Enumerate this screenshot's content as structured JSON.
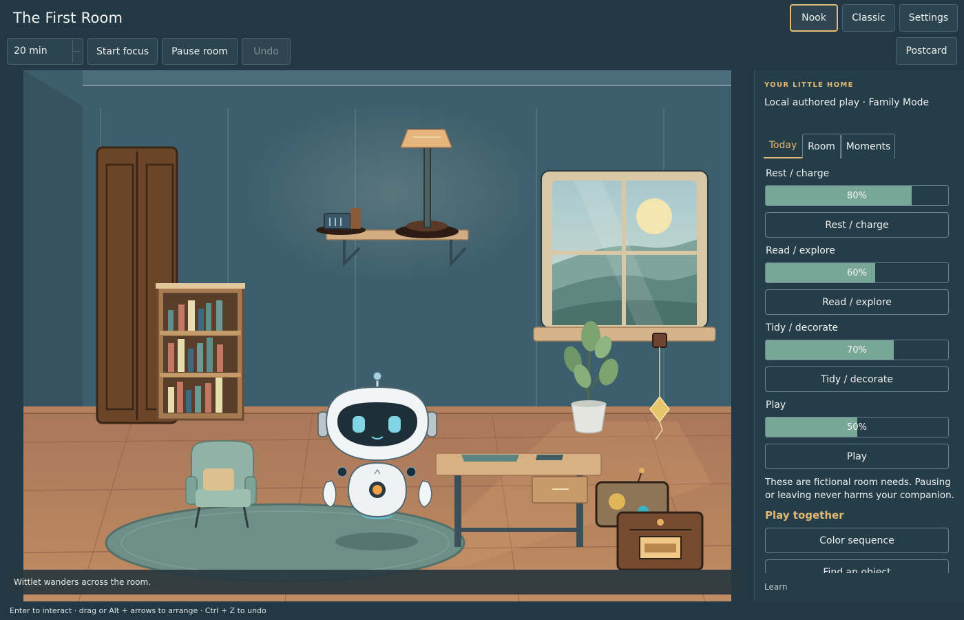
{
  "app": {
    "title": "The First Room"
  },
  "modes": {
    "nook": "Nook",
    "classic": "Classic",
    "settings": "Settings"
  },
  "toolbar": {
    "timer_value": "20 min",
    "start_focus": "Start focus",
    "pause_room": "Pause room",
    "undo": "Undo",
    "postcard": "Postcard"
  },
  "status": {
    "toast": "Wittlet wanders across the room.",
    "hint": "Enter to interact · drag or Alt + arrows to arrange · Ctrl + Z to undo"
  },
  "panel": {
    "kicker": "YOUR LITTLE HOME",
    "subtitle": "Local authored play · Family Mode",
    "tabs": [
      {
        "label": "Today"
      },
      {
        "label": "Room"
      },
      {
        "label": "Moments"
      }
    ],
    "needs": [
      {
        "label": "Rest / charge",
        "value": 80,
        "value_label": "80%",
        "button": "Rest / charge"
      },
      {
        "label": "Read / explore",
        "value": 60,
        "value_label": "60%",
        "button": "Read / explore"
      },
      {
        "label": "Tidy / decorate",
        "value": 70,
        "value_label": "70%",
        "button": "Tidy / decorate"
      },
      {
        "label": "Play",
        "value": 50,
        "value_label": "50%",
        "button": "Play"
      }
    ],
    "note": "These are fictional room needs. Pausing or leaving never harms your companion.",
    "play_heading": "Play together",
    "play_buttons": [
      "Color sequence",
      "Find an object"
    ],
    "learn": "Learn"
  },
  "colors": {
    "accent": "#e2bb73",
    "bar_fill": "#78a798",
    "background": "#223845",
    "wall": "#3e5f6e",
    "floor": "#b07e5a"
  }
}
